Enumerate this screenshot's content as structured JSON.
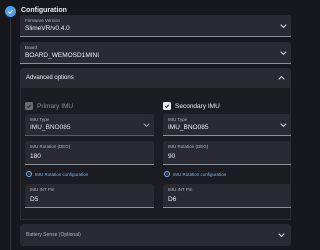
{
  "header": {
    "title": "Configuration"
  },
  "firmware": {
    "label": "Firmware Version",
    "value": "SlimeVR/v0.4.0"
  },
  "board": {
    "label": "Board",
    "value": "BOARD_WEMOSD1MINI"
  },
  "advanced": {
    "title": "Advanced options"
  },
  "primary_imu": {
    "title": "Primary IMU",
    "checked": true,
    "enabled": false,
    "imu_type": {
      "label": "IMU Type",
      "value": "IMU_BNO085"
    },
    "rotation": {
      "label": "IMU Rotation (DEG)",
      "value": "180"
    },
    "link": "IMU Rotation configuration",
    "int_pin": {
      "label": "IMU INT Pin",
      "value": "D5"
    }
  },
  "secondary_imu": {
    "title": "Secondary IMU",
    "checked": true,
    "enabled": true,
    "imu_type": {
      "label": "IMU Type",
      "value": "IMU_BNO085"
    },
    "rotation": {
      "label": "IMU Rotation (DEG)",
      "value": "90"
    },
    "link": "IMU Rotation configuration",
    "int_pin": {
      "label": "IMU INT Pin",
      "value": "D6"
    }
  },
  "battery": {
    "title": "Battery Sense (Optional)"
  },
  "colors": {
    "background": "#17181d",
    "field": "#2a2b32",
    "accent": "#4f9fe6",
    "link": "#7db3ee"
  },
  "icons": {
    "step": "check-circle-icon",
    "dropdown": "chevron-down-icon",
    "checkbox": "check-icon",
    "info": "info-icon"
  }
}
